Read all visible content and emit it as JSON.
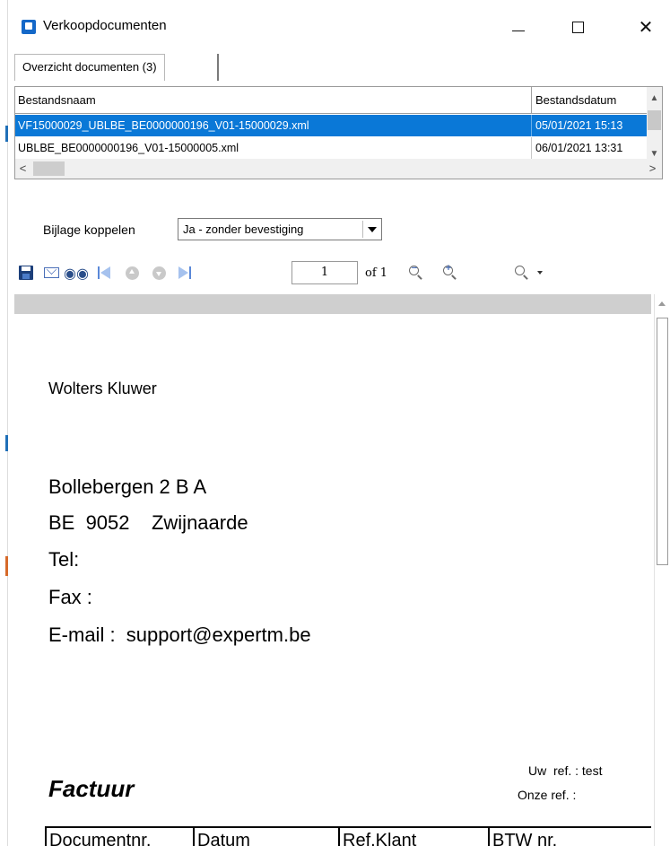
{
  "window": {
    "title": "Verkoopdocumenten",
    "controls": {
      "minimize": "—",
      "maximize": "☐",
      "close": "✕"
    }
  },
  "tabs": [
    {
      "label": "Overzicht documenten (3)"
    }
  ],
  "file_grid": {
    "columns": [
      "Bestandsnaam",
      "Bestandsdatum"
    ],
    "rows": [
      {
        "name": "VF15000029_UBLBE_BE0000000196_V01-15000029.xml",
        "date": "05/01/2021 15:13",
        "selected": true
      },
      {
        "name": "UBLBE_BE0000000196_V01-15000005.xml",
        "date": "06/01/2021 13:31",
        "selected": false
      }
    ],
    "scroll_left": "<",
    "scroll_right": ">",
    "scroll_up": "^",
    "scroll_down": "v"
  },
  "attach": {
    "label": "Bijlage koppelen",
    "selected": "Ja - zonder bevestiging"
  },
  "viewer_toolbar": {
    "page_number": "1",
    "page_of": "of 1",
    "icons": [
      "save-icon",
      "email-icon",
      "find-icon",
      "first-page-icon",
      "previous-page-icon",
      "next-page-icon",
      "last-page-icon",
      "zoom-out-icon",
      "zoom-in-icon",
      "zoom-dropdown-icon"
    ]
  },
  "document": {
    "company": "Wolters Kluwer",
    "address_lines": [
      "Bollebergen 2 B A",
      "BE  9052    Zwijnaarde",
      "Tel:",
      "Fax :",
      "E-mail :  support@expertm.be"
    ],
    "title": "Factuur",
    "uw_ref": "Uw  ref. : test",
    "onze_ref": "Onze ref. :",
    "table_headers": [
      "Documentnr.",
      "Datum",
      "Ref.Klant",
      "BTW nr."
    ]
  },
  "colors": {
    "selection": "#0a78d7",
    "app_icon": "#1468c8"
  }
}
